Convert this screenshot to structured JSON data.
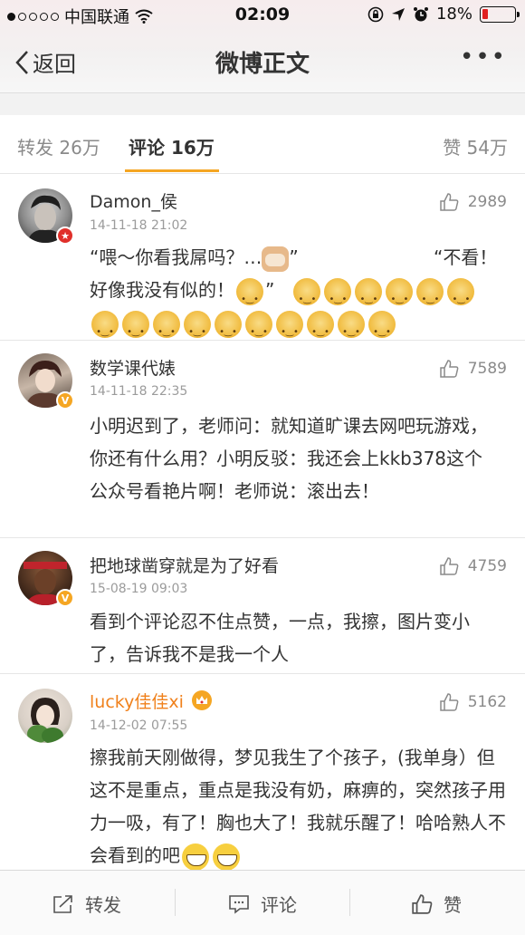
{
  "status_bar": {
    "carrier": "中国联通",
    "time": "02:09",
    "battery": "18%",
    "battery_level": 0.18
  },
  "nav": {
    "back_label": "返回",
    "title": "微博正文",
    "more": "•••"
  },
  "tabs": {
    "repost": "转发 26万",
    "comment": "评论 16万",
    "like": "赞 54万"
  },
  "comments": [
    {
      "username": "Damon_侯",
      "time": "14-11-18 21:02",
      "likes": "2989",
      "line1": "“喂～你看我屌吗？…",
      "line1b": "”",
      "line1c": "“不看！",
      "line2": "好像我没有似的！",
      "line2b": "”",
      "badge_color": "#e0302a"
    },
    {
      "username": "数学课代婊",
      "time": "14-11-18 22:35",
      "likes": "7589",
      "text": "小明迟到了，老师问：就知道旷课去网吧玩游戏，你还有什么用？小明反驳：我还会上kkb378这个公众号看艳片啊！老师说：滚出去！",
      "badge_color": "#f5a623"
    },
    {
      "username": "把地球凿穿就是为了好看",
      "time": "15-08-19 09:03",
      "likes": "4759",
      "text": "看到个评论忍不住点赞，一点，我擦，图片变小了，告诉我不是我一个人",
      "badge_color": "#f5a623"
    },
    {
      "username": "lucky佳佳xi",
      "time": "14-12-02 07:55",
      "likes": "5162",
      "text": "擦我前天刚做得，梦见我生了个孩子，(我单身）但这不是重点，重点是我没有奶，麻痹的，突然孩子用力一吸，有了！胸也大了！我就乐醒了！哈哈熟人不会看到的吧"
    }
  ],
  "bottom_bar": {
    "repost": "转发",
    "comment": "评论",
    "like": "赞"
  },
  "colors": {
    "accent": "#f5a623",
    "vip_name": "#f0811c"
  }
}
